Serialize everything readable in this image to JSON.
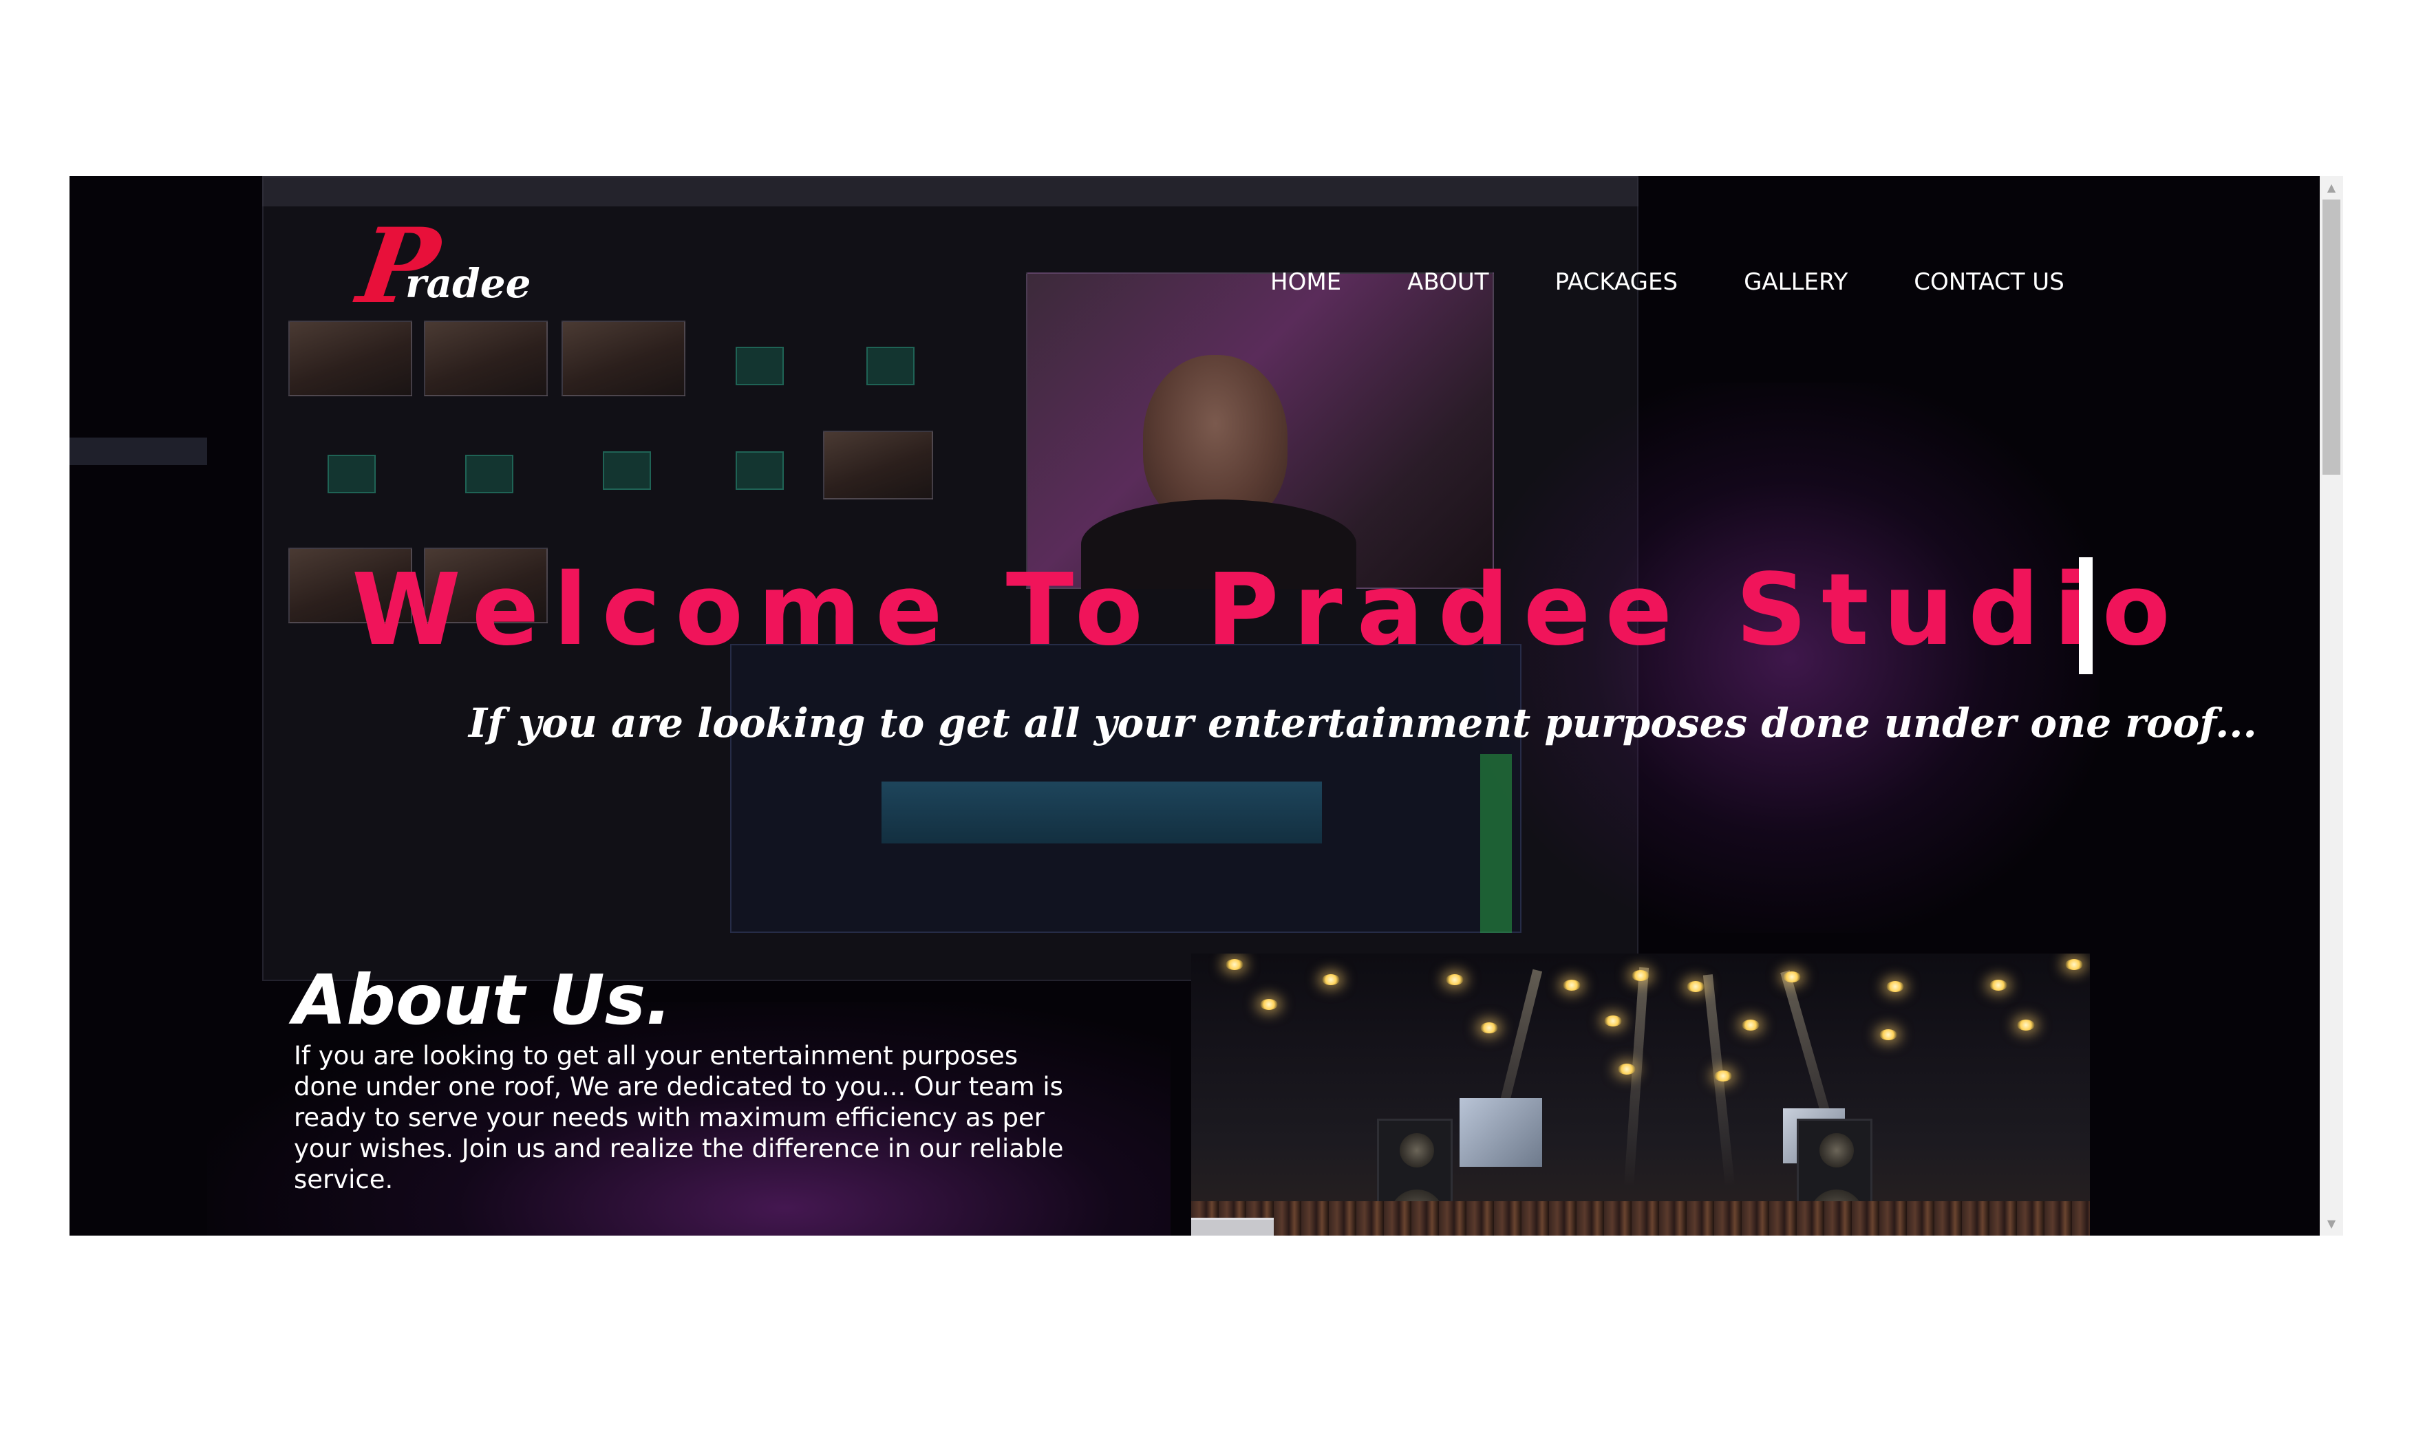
{
  "header": {
    "logo": {
      "initial": "P",
      "rest": "radee"
    },
    "nav": [
      {
        "label": "HOME"
      },
      {
        "label": "ABOUT"
      },
      {
        "label": "PACKAGES"
      },
      {
        "label": "GALLERY"
      },
      {
        "label": "CONTACT US"
      }
    ]
  },
  "hero": {
    "title": "Welcome To Pradee Studio",
    "subtitle": "If you are looking to get all your entertainment purposes done under one roof..."
  },
  "about": {
    "title": "About Us.",
    "text": "If you are looking to get all your entertainment purposes done under one roof, We are dedicated to you... Our team is ready to serve your needs with maximum efficiency as per your wishes. Join us and realize the difference in our reliable service."
  },
  "colors": {
    "accent": "#f0145a",
    "logo_red": "#e8103a",
    "background": "#050308",
    "text": "#ffffff"
  },
  "icons": {
    "scroll_up": "scroll-up-arrow-icon",
    "scroll_down": "scroll-down-arrow-icon"
  }
}
